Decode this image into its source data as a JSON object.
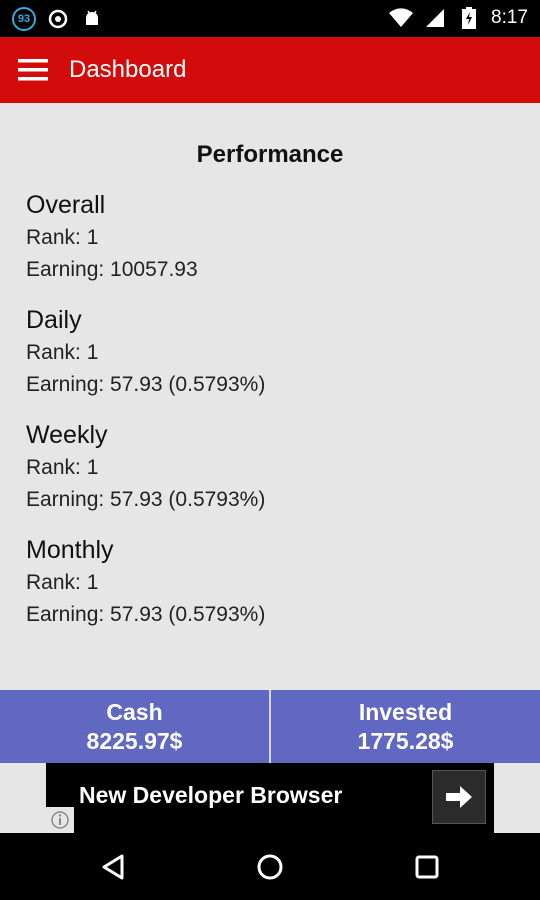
{
  "status_bar": {
    "notification_badge": "93",
    "time": "8:17"
  },
  "app_bar": {
    "title": "Dashboard"
  },
  "performance": {
    "title": "Performance",
    "sections": [
      {
        "label": "Overall",
        "rank": "Rank: 1",
        "earning": "Earning: 10057.93"
      },
      {
        "label": "Daily",
        "rank": "Rank: 1",
        "earning": "Earning: 57.93 (0.5793%)"
      },
      {
        "label": "Weekly",
        "rank": "Rank: 1",
        "earning": "Earning: 57.93 (0.5793%)"
      },
      {
        "label": "Monthly",
        "rank": "Rank: 1",
        "earning": "Earning: 57.93 (0.5793%)"
      }
    ]
  },
  "stats": {
    "cash": {
      "label": "Cash",
      "value": "8225.97$"
    },
    "invested": {
      "label": "Invested",
      "value": "1775.28$"
    }
  },
  "ad": {
    "text": "New Developer Browser"
  },
  "colors": {
    "app_bar": "#d20b0b",
    "stats_bar": "#6068c2",
    "background": "#e6e6e6"
  }
}
